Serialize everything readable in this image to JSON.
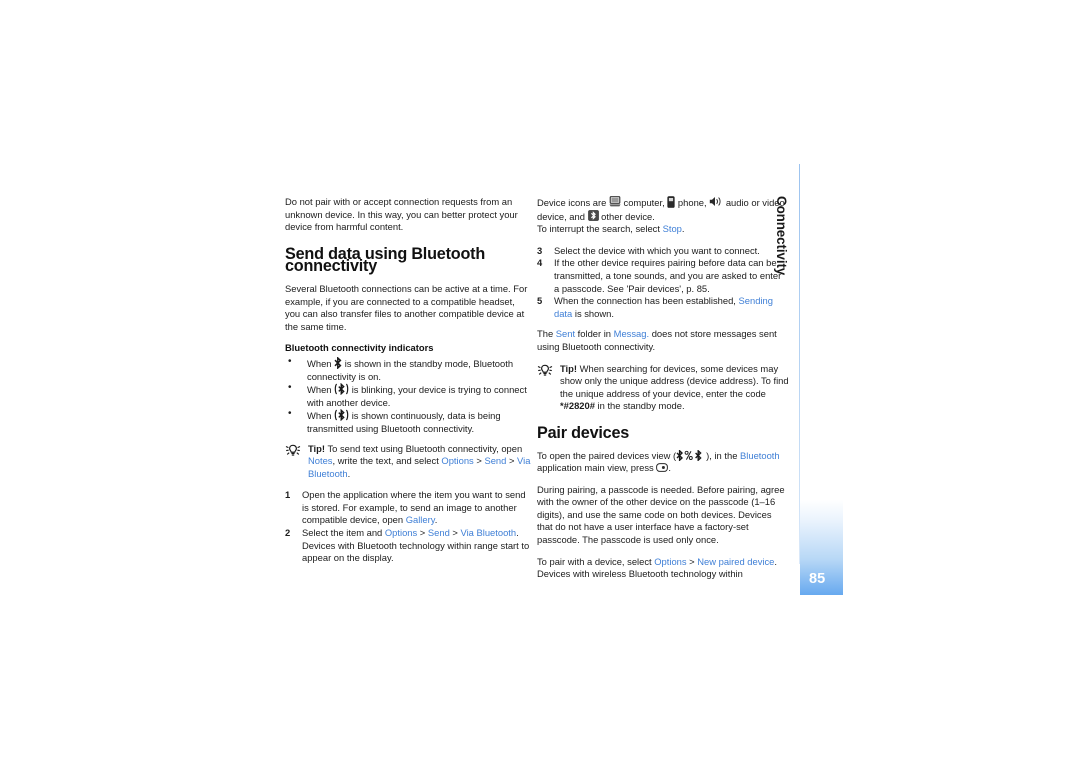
{
  "document": {
    "section_tab": "Connectivity",
    "page_number": "85",
    "accent_link_color": "#3f7fd6",
    "tab_gradient_color": "#67a9ef"
  },
  "left_column": {
    "intro_paragraph": "Do not pair with or accept connection requests from an unknown device. In this way, you can better protect your device from harmful content.",
    "heading": "Send data using Bluetooth connectivity",
    "paragraph_1": "Several Bluetooth connections can be active at a time. For example, if you are connected to a compatible headset, you can also transfer files to another compatible device at the same time.",
    "subheading": "Bluetooth connectivity indicators",
    "bullets": [
      {
        "before": "When",
        "icon": "bluetooth-icon",
        "after": "is shown in the standby mode, Bluetooth connectivity is on."
      },
      {
        "before": "When",
        "icon": "bluetooth-transfer-icon",
        "after": "is blinking, your device is trying to connect with another device."
      },
      {
        "before": "When",
        "icon": "bluetooth-transfer-icon",
        "after": "is shown continuously, data is being transmitted using Bluetooth connectivity."
      }
    ],
    "tip": {
      "icon": "tip-bulb-icon",
      "label": "Tip!",
      "text_1": "To send text using Bluetooth connectivity, open",
      "link_1": "Notes",
      "text_2": ", write the text, and select",
      "link_2": "Options",
      "sep_1": ">",
      "link_3": "Send",
      "sep_2": ">",
      "link_4": "Via Bluetooth",
      "text_3": "."
    },
    "steps": [
      {
        "num": "1",
        "text_1": "Open the application where the item you want to send is stored. For example, to send an image to another compatible device, open",
        "link_1": "Gallery",
        "text_2": "."
      },
      {
        "num": "2",
        "text_1": "Select the item and",
        "link_1": "Options",
        "sep_1": ">",
        "link_2": "Send",
        "sep_2": ">",
        "link_3": "Via Bluetooth",
        "text_2": ". Devices with Bluetooth technology within range start to appear on the display."
      }
    ]
  },
  "right_column": {
    "device_icons_line": {
      "text_1": "Device icons are",
      "icon_1": "computer-icon",
      "text_2": "computer,",
      "icon_2": "phone-icon",
      "text_3": "phone,",
      "icon_3": "audio-device-icon",
      "text_4": "audio or video device, and",
      "icon_4": "other-device-icon",
      "text_5": "other device."
    },
    "interrupt_line": {
      "text_1": "To interrupt the search, select",
      "link_1": "Stop",
      "text_2": "."
    },
    "steps": [
      {
        "num": "3",
        "text_1": "Select the device with which you want to connect."
      },
      {
        "num": "4",
        "text_1": "If the other device requires pairing before data can be transmitted, a tone sounds, and you are asked to enter a passcode. See 'Pair devices', p. 85."
      },
      {
        "num": "5",
        "text_1": "When the connection has been established,",
        "link_1": "Sending data",
        "text_2": "is shown."
      }
    ],
    "sent_folder_paragraph": {
      "text_1": "The",
      "link_1": "Sent",
      "text_2": "folder in",
      "link_2": "Messag.",
      "text_3": "does not store messages sent using Bluetooth connectivity."
    },
    "tip": {
      "icon": "tip-bulb-icon",
      "label": "Tip!",
      "text_1": "When searching for devices, some devices may show only the unique address (device address). To find the unique address of your device, enter the code",
      "code": "*#2820#",
      "text_2": "in the standby mode."
    },
    "heading": "Pair devices",
    "paired_view_paragraph": {
      "text_1": "To open the paired devices view (",
      "icon_1": "bluetooth-paired-icon",
      "text_2": "), in the",
      "link_1": "Bluetooth",
      "text_3": "application main view, press",
      "icon_2": "scroll-key-icon",
      "text_4": "."
    },
    "pairing_paragraph": "During pairing, a passcode is needed. Before pairing, agree with the owner of the other device on the passcode (1–16 digits), and use the same code on both devices. Devices that do not have a user interface have a factory-set passcode. The passcode is used only once.",
    "pair_with_paragraph": {
      "text_1": "To pair with a device, select",
      "link_1": "Options",
      "sep_1": ">",
      "link_2": "New paired device",
      "text_2": ". Devices with wireless Bluetooth technology within"
    }
  }
}
